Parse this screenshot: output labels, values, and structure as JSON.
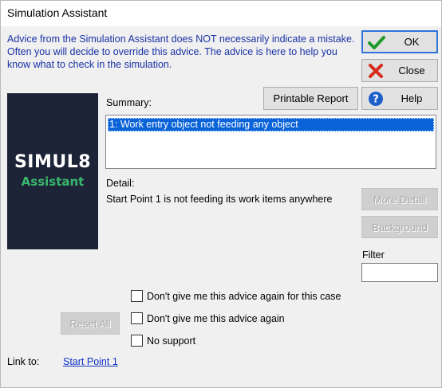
{
  "window": {
    "title": "Simulation Assistant"
  },
  "advice_text": "Advice from the Simulation Assistant does NOT necessarily indicate a mistake.  Often you will decide to override this advice.  The advice is here to help you know what to check in the simulation.",
  "buttons": {
    "ok": "OK",
    "close": "Close",
    "help": "Help",
    "printable_report": "Printable Report",
    "more_detail": "More Detail",
    "background": "Background",
    "reset_all": "Reset All"
  },
  "logo": {
    "line1": "SIMUL8",
    "line2": "Assistant"
  },
  "summary": {
    "label": "Summary:",
    "items": [
      "1: Work entry object not feeding any object"
    ]
  },
  "detail": {
    "label": "Detail:",
    "text": "Start Point 1 is not feeding its work items anywhere"
  },
  "filter": {
    "label": "Filter",
    "value": ""
  },
  "checkboxes": [
    {
      "label": "Don't give me this advice again for this case",
      "checked": false
    },
    {
      "label": "Don't give me this advice again",
      "checked": false
    },
    {
      "label": "No support",
      "checked": false
    }
  ],
  "link": {
    "label": "Link to:",
    "target": "Start Point 1"
  },
  "colors": {
    "advice_text": "#1a32a6",
    "selection": "#0a63d9",
    "logo_bg": "#1e2438",
    "logo_accent": "#38b76c"
  }
}
